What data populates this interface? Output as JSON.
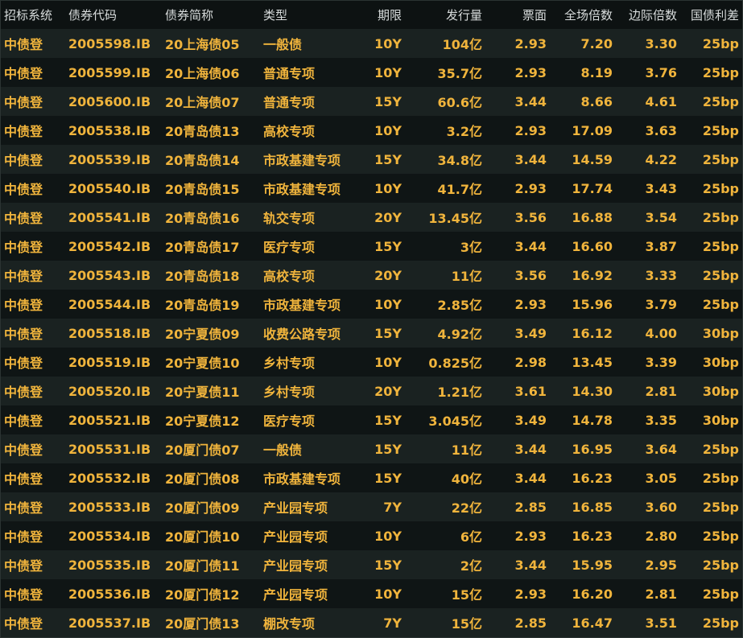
{
  "table": {
    "headers": [
      "招标系统",
      "债券代码",
      "债券简称",
      "类型",
      "期限",
      "发行量",
      "票面",
      "全场倍数",
      "边际倍数",
      "国债利差"
    ],
    "rows": [
      [
        "中债登",
        "2005598.IB",
        "20上海债05",
        "一般债",
        "10Y",
        "104亿",
        "2.93",
        "7.20",
        "3.30",
        "25bp"
      ],
      [
        "中债登",
        "2005599.IB",
        "20上海债06",
        "普通专项",
        "10Y",
        "35.7亿",
        "2.93",
        "8.19",
        "3.76",
        "25bp"
      ],
      [
        "中债登",
        "2005600.IB",
        "20上海债07",
        "普通专项",
        "15Y",
        "60.6亿",
        "3.44",
        "8.66",
        "4.61",
        "25bp"
      ],
      [
        "中债登",
        "2005538.IB",
        "20青岛债13",
        "高校专项",
        "10Y",
        "3.2亿",
        "2.93",
        "17.09",
        "3.63",
        "25bp"
      ],
      [
        "中债登",
        "2005539.IB",
        "20青岛债14",
        "市政基建专项",
        "15Y",
        "34.8亿",
        "3.44",
        "14.59",
        "4.22",
        "25bp"
      ],
      [
        "中债登",
        "2005540.IB",
        "20青岛债15",
        "市政基建专项",
        "10Y",
        "41.7亿",
        "2.93",
        "17.74",
        "3.43",
        "25bp"
      ],
      [
        "中债登",
        "2005541.IB",
        "20青岛债16",
        "轨交专项",
        "20Y",
        "13.45亿",
        "3.56",
        "16.88",
        "3.54",
        "25bp"
      ],
      [
        "中债登",
        "2005542.IB",
        "20青岛债17",
        "医疗专项",
        "15Y",
        "3亿",
        "3.44",
        "16.60",
        "3.87",
        "25bp"
      ],
      [
        "中债登",
        "2005543.IB",
        "20青岛债18",
        "高校专项",
        "20Y",
        "11亿",
        "3.56",
        "16.92",
        "3.33",
        "25bp"
      ],
      [
        "中债登",
        "2005544.IB",
        "20青岛债19",
        "市政基建专项",
        "10Y",
        "2.85亿",
        "2.93",
        "15.96",
        "3.79",
        "25bp"
      ],
      [
        "中债登",
        "2005518.IB",
        "20宁夏债09",
        "收费公路专项",
        "15Y",
        "4.92亿",
        "3.49",
        "16.12",
        "4.00",
        "30bp"
      ],
      [
        "中债登",
        "2005519.IB",
        "20宁夏债10",
        "乡村专项",
        "10Y",
        "0.825亿",
        "2.98",
        "13.45",
        "3.39",
        "30bp"
      ],
      [
        "中债登",
        "2005520.IB",
        "20宁夏债11",
        "乡村专项",
        "20Y",
        "1.21亿",
        "3.61",
        "14.30",
        "2.81",
        "30bp"
      ],
      [
        "中债登",
        "2005521.IB",
        "20宁夏债12",
        "医疗专项",
        "15Y",
        "3.045亿",
        "3.49",
        "14.78",
        "3.35",
        "30bp"
      ],
      [
        "中债登",
        "2005531.IB",
        "20厦门债07",
        "一般债",
        "15Y",
        "11亿",
        "3.44",
        "16.95",
        "3.64",
        "25bp"
      ],
      [
        "中债登",
        "2005532.IB",
        "20厦门债08",
        "市政基建专项",
        "15Y",
        "40亿",
        "3.44",
        "16.23",
        "3.05",
        "25bp"
      ],
      [
        "中债登",
        "2005533.IB",
        "20厦门债09",
        "产业园专项",
        "7Y",
        "22亿",
        "2.85",
        "16.85",
        "3.60",
        "25bp"
      ],
      [
        "中债登",
        "2005534.IB",
        "20厦门债10",
        "产业园专项",
        "10Y",
        "6亿",
        "2.93",
        "16.23",
        "2.80",
        "25bp"
      ],
      [
        "中债登",
        "2005535.IB",
        "20厦门债11",
        "产业园专项",
        "15Y",
        "2亿",
        "3.44",
        "15.95",
        "2.95",
        "25bp"
      ],
      [
        "中债登",
        "2005536.IB",
        "20厦门债12",
        "产业园专项",
        "10Y",
        "15亿",
        "2.93",
        "16.20",
        "2.81",
        "25bp"
      ],
      [
        "中债登",
        "2005537.IB",
        "20厦门债13",
        "棚改专项",
        "7Y",
        "15亿",
        "2.85",
        "16.47",
        "3.51",
        "25bp"
      ]
    ]
  },
  "colors": {
    "background": "#0f1414",
    "header_text": "#d8dcdc",
    "cell_text": "#f0b43c",
    "row_odd": "#1a2221",
    "row_even": "#0f1515"
  }
}
